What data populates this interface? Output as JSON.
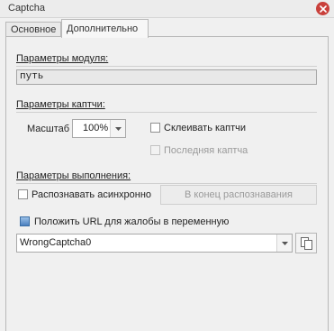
{
  "window": {
    "title": "Captcha"
  },
  "tabs": [
    {
      "label": "Основное",
      "active": false
    },
    {
      "label": "Дополнительно",
      "active": true
    }
  ],
  "module": {
    "heading": "Параметры модуля:",
    "path_value": "путь"
  },
  "captcha": {
    "heading": "Параметры каптчи:",
    "scale_label": "Масштаб",
    "scale_value": "100%",
    "glue_label": "Склеивать каптчи",
    "glue_checked": false,
    "last_label": "Последняя каптча",
    "last_checked": false,
    "last_enabled": false
  },
  "execution": {
    "heading": "Параметры выполнения:",
    "async_label": "Распознавать асинхронно",
    "async_checked": false,
    "queue_button": "В конец распознавания",
    "queue_enabled": false
  },
  "complaint": {
    "label": "Положить URL для жалобы в переменную",
    "checked": true,
    "variable_value": "WrongCaptcha0"
  },
  "icons": {
    "close": "close-icon",
    "dropdown": "chevron-down-icon",
    "copy": "copy-icon"
  },
  "colors": {
    "close": "#c9403b",
    "checked": "#4a7fbf"
  }
}
